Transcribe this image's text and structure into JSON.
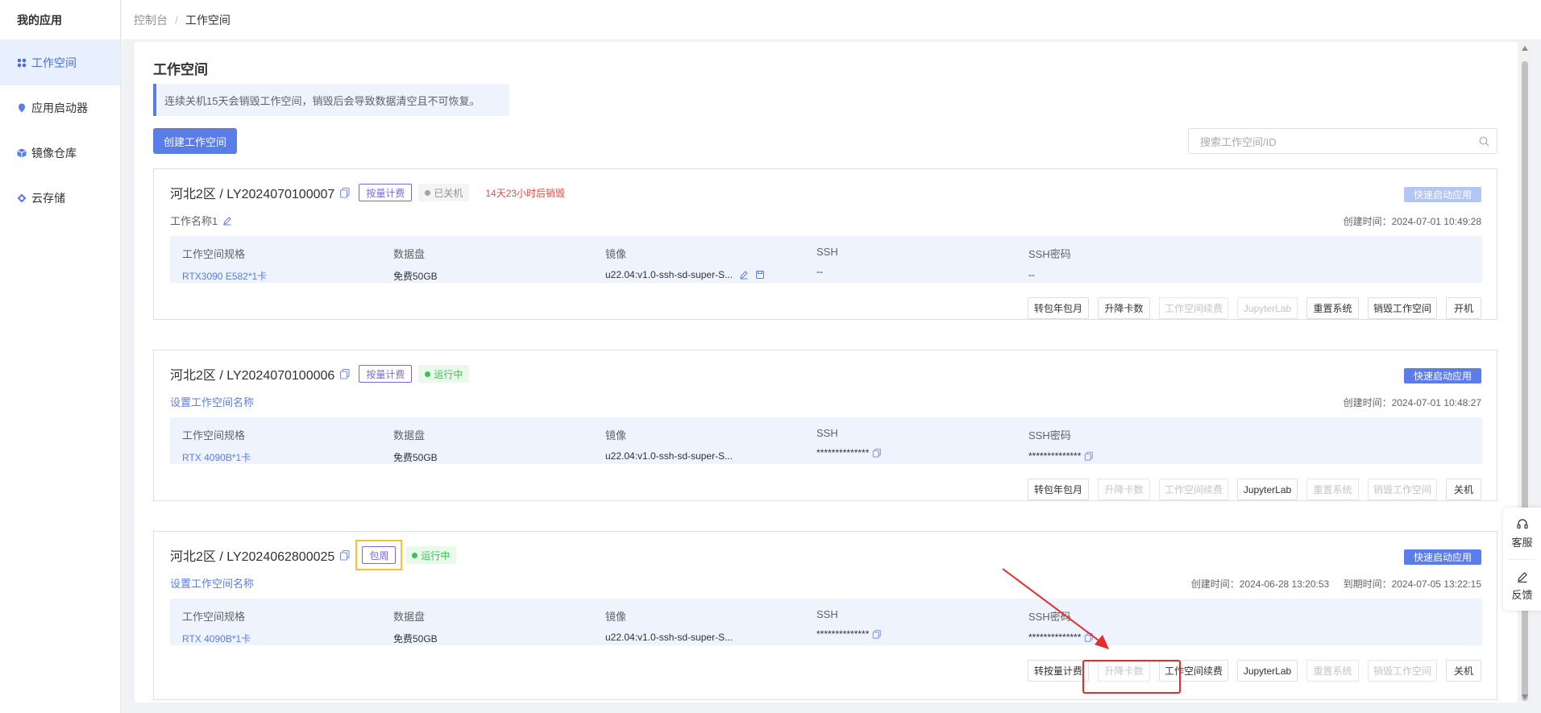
{
  "sidebar": {
    "title": "我的应用",
    "items": [
      {
        "label": "工作空间",
        "icon": "workspace-icon",
        "active": true
      },
      {
        "label": "应用启动器",
        "icon": "launcher-icon",
        "active": false
      },
      {
        "label": "镜像仓库",
        "icon": "image-repo-icon",
        "active": false
      },
      {
        "label": "云存储",
        "icon": "cloud-storage-icon",
        "active": false
      }
    ]
  },
  "breadcrumb": {
    "root": "控制台",
    "sep": "/",
    "current": "工作空间"
  },
  "page": {
    "title": "工作空间",
    "notice": "连续关机15天会销毁工作空间，销毁后会导致数据清空且不可恢复。",
    "create_label": "创建工作空间",
    "search_placeholder": "搜索工作空间/ID"
  },
  "spec_labels": {
    "spec": "工作空间规格",
    "disk": "数据盘",
    "image": "镜像",
    "ssh": "SSH",
    "ssh_pwd": "SSH密码"
  },
  "quick_label": "快速启动应用",
  "cards": [
    {
      "title": "河北2区 / LY2024070100007",
      "billing": "按量计费",
      "status": "已关机",
      "warning": "14天23小时后销毁",
      "name": "工作名称1",
      "created": "创建时间：2024-07-01 10:49:28",
      "expires": "",
      "spec": "RTX3090 E582*1卡",
      "disk": "免费50GB",
      "image": "u22.04:v1.0-ssh-sd-super-S...",
      "ssh": "--",
      "ssh_pwd": "--",
      "actions": [
        {
          "label": "转包年包月",
          "enabled": true
        },
        {
          "label": "升降卡数",
          "enabled": true
        },
        {
          "label": "工作空间续费",
          "enabled": false
        },
        {
          "label": "JupyterLab",
          "enabled": false
        },
        {
          "label": "重置系统",
          "enabled": true
        },
        {
          "label": "销毁工作空间",
          "enabled": true
        },
        {
          "label": "开机",
          "enabled": true
        }
      ]
    },
    {
      "title": "河北2区 / LY2024070100006",
      "billing": "按量计费",
      "status": "运行中",
      "warning": "",
      "name": "设置工作空间名称",
      "created": "创建时间：2024-07-01 10:48:27",
      "expires": "",
      "spec": "RTX 4090B*1卡",
      "disk": "免费50GB",
      "image": "u22.04:v1.0-ssh-sd-super-S...",
      "ssh": "**************",
      "ssh_pwd": "**************",
      "actions": [
        {
          "label": "转包年包月",
          "enabled": true
        },
        {
          "label": "升降卡数",
          "enabled": false
        },
        {
          "label": "工作空间续费",
          "enabled": false
        },
        {
          "label": "JupyterLab",
          "enabled": true
        },
        {
          "label": "重置系统",
          "enabled": false
        },
        {
          "label": "销毁工作空间",
          "enabled": false
        },
        {
          "label": "关机",
          "enabled": true
        }
      ]
    },
    {
      "title": "河北2区 / LY2024062800025",
      "billing": "包周",
      "status": "运行中",
      "warning": "",
      "name": "设置工作空间名称",
      "created": "创建时间：2024-06-28 13:20:53",
      "expires": "到期时间：2024-07-05 13:22:15",
      "spec": "RTX 4090B*1卡",
      "disk": "免费50GB",
      "image": "u22.04:v1.0-ssh-sd-super-S...",
      "ssh": "**************",
      "ssh_pwd": "**************",
      "actions": [
        {
          "label": "转按量计费",
          "enabled": true
        },
        {
          "label": "升降卡数",
          "enabled": false
        },
        {
          "label": "工作空间续费",
          "enabled": true
        },
        {
          "label": "JupyterLab",
          "enabled": true
        },
        {
          "label": "重置系统",
          "enabled": false
        },
        {
          "label": "销毁工作空间",
          "enabled": false
        },
        {
          "label": "关机",
          "enabled": true
        }
      ]
    }
  ],
  "float": {
    "service": "客服",
    "feedback": "反馈"
  },
  "colors": {
    "accent": "#5a7de8",
    "running": "#3fbf57",
    "danger": "#f04646",
    "highlight": "#f3c431",
    "annotation": "#e52b2b"
  }
}
